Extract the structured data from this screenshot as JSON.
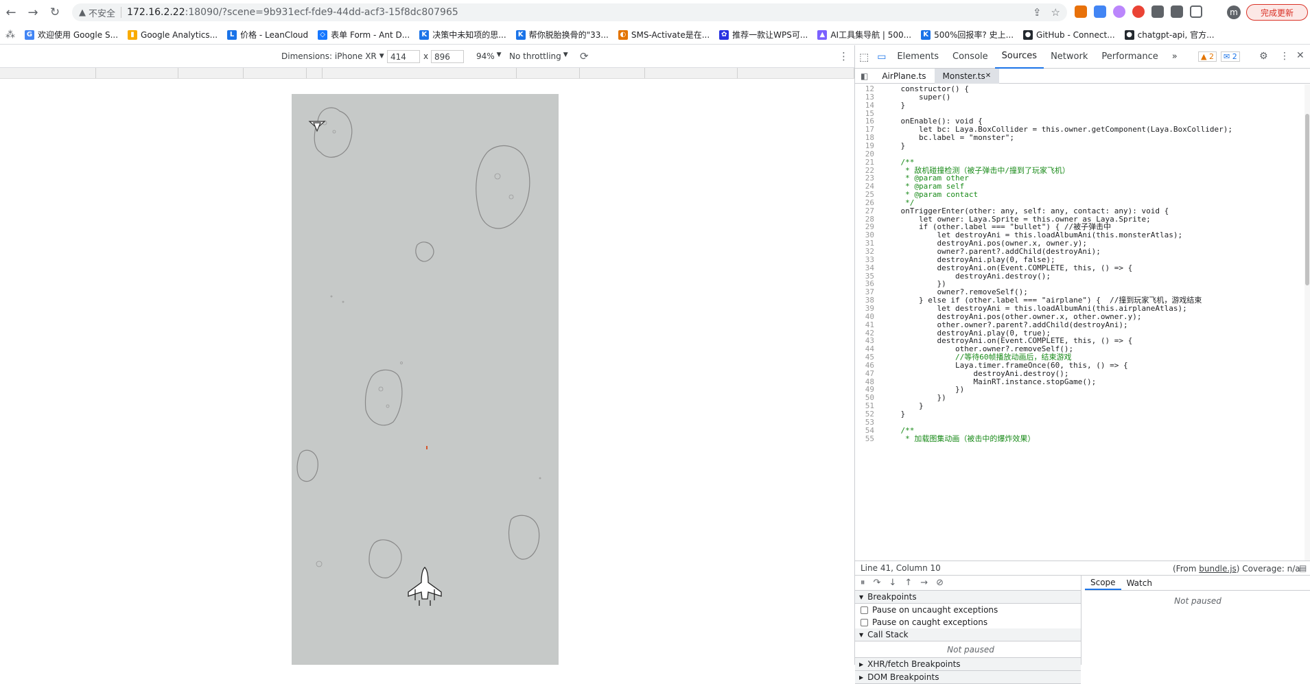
{
  "browser": {
    "security_label": "不安全",
    "url_host": "172.16.2.22",
    "url_rest": ":18090/?scene=9b931ecf-fde9-44dd-acf3-15f8dc807965",
    "update_button": "完成更新",
    "profile_initial": "m"
  },
  "bookmarks": [
    {
      "label": "欢迎使用 Google S...",
      "color": "#4285f4",
      "glyph": "G"
    },
    {
      "label": "Google Analytics...",
      "color": "#f9ab00",
      "glyph": "▮"
    },
    {
      "label": "价格 - LeanCloud",
      "color": "#1a73e8",
      "glyph": "L"
    },
    {
      "label": "表单 Form - Ant D...",
      "color": "#1677ff",
      "glyph": "◇"
    },
    {
      "label": "决策中未知项的思...",
      "color": "#1a73e8",
      "glyph": "K"
    },
    {
      "label": "帮你脱胎换骨的\"33...",
      "color": "#1a73e8",
      "glyph": "K"
    },
    {
      "label": "SMS-Activate是在...",
      "color": "#e37400",
      "glyph": "◐"
    },
    {
      "label": "推荐一款让WPS可...",
      "color": "#2932e1",
      "glyph": "✿"
    },
    {
      "label": "AI工具集导航 | 500...",
      "color": "#7b61ff",
      "glyph": "▲"
    },
    {
      "label": "500%回报率? 史上...",
      "color": "#1a73e8",
      "glyph": "K"
    },
    {
      "label": "GitHub - Connect...",
      "color": "#24292f",
      "glyph": "●"
    },
    {
      "label": "chatgpt-api, 官方...",
      "color": "#24292f",
      "glyph": "●"
    }
  ],
  "device_toolbar": {
    "dimensions_label": "Dimensions: iPhone XR",
    "width": "414",
    "times": "x",
    "height": "896",
    "zoom": "94%",
    "throttling": "No throttling"
  },
  "devtools": {
    "tabs": [
      "Elements",
      "Console",
      "Sources",
      "Network",
      "Performance"
    ],
    "active_tab": "Sources",
    "more_tabs": "»",
    "warnings_count": "2",
    "messages_count": "2",
    "file_tabs": [
      "AirPlane.ts",
      "Monster.ts"
    ],
    "active_file": "Monster.ts",
    "status_position": "Line 41, Column 10",
    "status_source_prefix": "(From ",
    "status_source_file": "bundle.js",
    "status_source_suffix": ") Coverage: n/a",
    "scope_tab": "Scope",
    "watch_tab": "Watch",
    "scope_status": "Not paused",
    "breakpoints_header": "Breakpoints",
    "pause_uncaught": "Pause on uncaught exceptions",
    "pause_caught": "Pause on caught exceptions",
    "call_stack_header": "Call Stack",
    "call_stack_status": "Not paused",
    "xhr_breakpoints": "XHR/fetch Breakpoints",
    "dom_breakpoints": "DOM Breakpoints"
  },
  "code_lines": [
    {
      "n": "12",
      "t": "    constructor() {"
    },
    {
      "n": "13",
      "t": "        super()"
    },
    {
      "n": "14",
      "t": "    }"
    },
    {
      "n": "15",
      "t": ""
    },
    {
      "n": "16",
      "t": "    onEnable(): void {"
    },
    {
      "n": "17",
      "t": "        let bc: Laya.BoxCollider = this.owner.getComponent(Laya.BoxCollider);"
    },
    {
      "n": "18",
      "t": "        bc.label = \"monster\";"
    },
    {
      "n": "19",
      "t": "    }"
    },
    {
      "n": "20",
      "t": ""
    },
    {
      "n": "21",
      "t": "    /**"
    },
    {
      "n": "22",
      "t": "     * 敌机碰撞检测（被子弹击中/撞到了玩家飞机）"
    },
    {
      "n": "23",
      "t": "     * @param other"
    },
    {
      "n": "24",
      "t": "     * @param self"
    },
    {
      "n": "25",
      "t": "     * @param contact"
    },
    {
      "n": "26",
      "t": "     */"
    },
    {
      "n": "27",
      "t": "    onTriggerEnter(other: any, self: any, contact: any): void {"
    },
    {
      "n": "28",
      "t": "        let owner: Laya.Sprite = this.owner as Laya.Sprite;"
    },
    {
      "n": "29",
      "t": "        if (other.label === \"bullet\") { //被子弹击中"
    },
    {
      "n": "30",
      "t": "            let destroyAni = this.loadAlbumAni(this.monsterAtlas);"
    },
    {
      "n": "31",
      "t": "            destroyAni.pos(owner.x, owner.y);"
    },
    {
      "n": "32",
      "t": "            owner?.parent?.addChild(destroyAni);"
    },
    {
      "n": "33",
      "t": "            destroyAni.play(0, false);"
    },
    {
      "n": "34",
      "t": "            destroyAni.on(Event.COMPLETE, this, () => {"
    },
    {
      "n": "35",
      "t": "                destroyAni.destroy();"
    },
    {
      "n": "36",
      "t": "            })"
    },
    {
      "n": "37",
      "t": "            owner?.removeSelf();"
    },
    {
      "n": "38",
      "t": "        } else if (other.label === \"airplane\") {  //撞到玩家飞机，游戏结束"
    },
    {
      "n": "39",
      "t": "            let destroyAni = this.loadAlbumAni(this.airplaneAtlas);"
    },
    {
      "n": "40",
      "t": "            destroyAni.pos(other.owner.x, other.owner.y);"
    },
    {
      "n": "41",
      "t": "            other.owner?.parent?.addChild(destroyAni);"
    },
    {
      "n": "42",
      "t": "            destroyAni.play(0, true);"
    },
    {
      "n": "43",
      "t": "            destroyAni.on(Event.COMPLETE, this, () => {"
    },
    {
      "n": "44",
      "t": "                other.owner?.removeSelf();"
    },
    {
      "n": "45",
      "t": "                //等待60帧播放动画后，结束游戏"
    },
    {
      "n": "46",
      "t": "                Laya.timer.frameOnce(60, this, () => {"
    },
    {
      "n": "47",
      "t": "                    destroyAni.destroy();"
    },
    {
      "n": "48",
      "t": "                    MainRT.instance.stopGame();"
    },
    {
      "n": "49",
      "t": "                })"
    },
    {
      "n": "50",
      "t": "            })"
    },
    {
      "n": "51",
      "t": "        }"
    },
    {
      "n": "52",
      "t": "    }"
    },
    {
      "n": "53",
      "t": ""
    },
    {
      "n": "54",
      "t": "    /**"
    },
    {
      "n": "55",
      "t": "     * 加载图集动画（被击中的爆炸效果）"
    }
  ]
}
